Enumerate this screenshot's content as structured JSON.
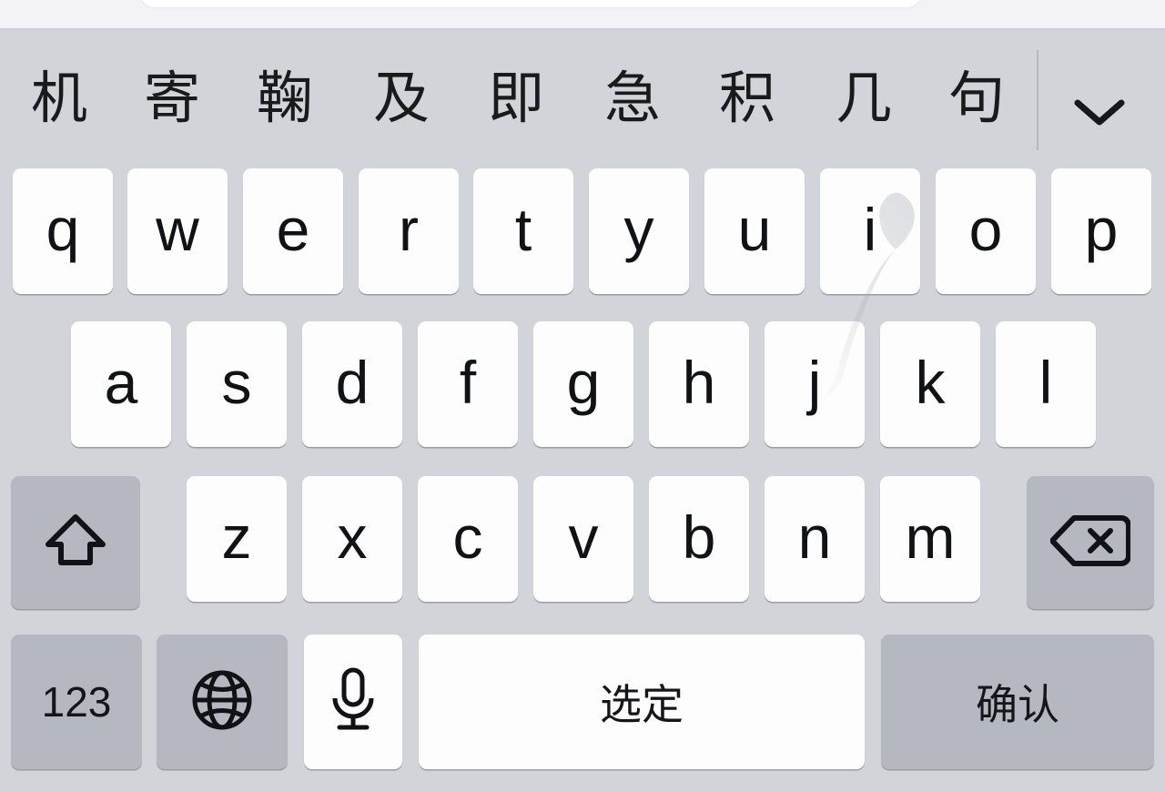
{
  "app": {
    "text_field_visible": true
  },
  "keyboard": {
    "language": "Chinese Pinyin",
    "colors": {
      "keyboard_background": "#d2d4d9",
      "key_white": "#fdfdfd",
      "key_gray": "#b5b8c0",
      "key_text": "#111215",
      "divider": "#b6b8be",
      "app_background": "#f3f3f5"
    },
    "candidate_bar": {
      "candidates": [
        "机",
        "寄",
        "鞠",
        "及",
        "即",
        "急",
        "积",
        "几",
        "句"
      ],
      "expand_icon": "chevron-down-icon",
      "divider_visible": true
    },
    "rows": {
      "row1": [
        "q",
        "w",
        "e",
        "r",
        "t",
        "y",
        "u",
        "i",
        "o",
        "p"
      ],
      "row2": [
        "a",
        "s",
        "d",
        "f",
        "g",
        "h",
        "j",
        "k",
        "l"
      ],
      "row3_letters": [
        "z",
        "x",
        "c",
        "v",
        "b",
        "n",
        "m"
      ],
      "shift": {
        "icon": "shift-arrow-icon",
        "label": ""
      },
      "backspace": {
        "icon": "backspace-delete-icon",
        "label": ""
      },
      "row4": {
        "numbers": {
          "label": "123",
          "icon": ""
        },
        "globe": {
          "label": "",
          "icon": "globe-icon"
        },
        "dictation": {
          "label": "",
          "icon": "microphone-icon"
        },
        "space": {
          "label": "选定",
          "icon": ""
        },
        "return": {
          "label": "确认",
          "icon": ""
        }
      }
    },
    "overlay": {
      "swipe_trail_visible": true,
      "swipe_from_key": "i",
      "swipe_to_key": "j"
    }
  }
}
